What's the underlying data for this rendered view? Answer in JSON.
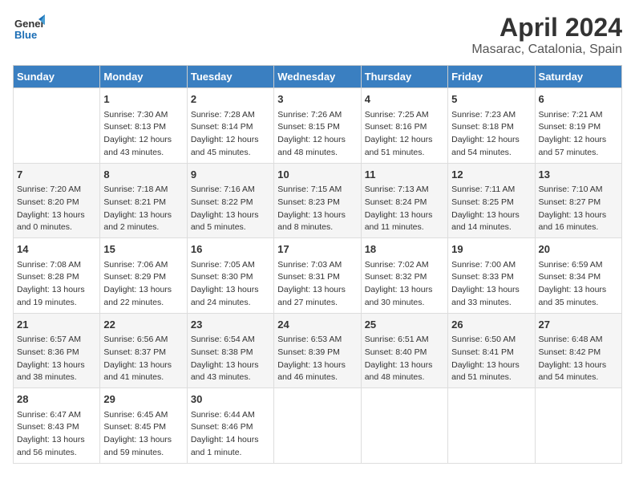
{
  "header": {
    "logo_general": "General",
    "logo_blue": "Blue",
    "month_title": "April 2024",
    "location": "Masarac, Catalonia, Spain"
  },
  "weekdays": [
    "Sunday",
    "Monday",
    "Tuesday",
    "Wednesday",
    "Thursday",
    "Friday",
    "Saturday"
  ],
  "weeks": [
    [
      {
        "day": "",
        "info": ""
      },
      {
        "day": "1",
        "info": "Sunrise: 7:30 AM\nSunset: 8:13 PM\nDaylight: 12 hours\nand 43 minutes."
      },
      {
        "day": "2",
        "info": "Sunrise: 7:28 AM\nSunset: 8:14 PM\nDaylight: 12 hours\nand 45 minutes."
      },
      {
        "day": "3",
        "info": "Sunrise: 7:26 AM\nSunset: 8:15 PM\nDaylight: 12 hours\nand 48 minutes."
      },
      {
        "day": "4",
        "info": "Sunrise: 7:25 AM\nSunset: 8:16 PM\nDaylight: 12 hours\nand 51 minutes."
      },
      {
        "day": "5",
        "info": "Sunrise: 7:23 AM\nSunset: 8:18 PM\nDaylight: 12 hours\nand 54 minutes."
      },
      {
        "day": "6",
        "info": "Sunrise: 7:21 AM\nSunset: 8:19 PM\nDaylight: 12 hours\nand 57 minutes."
      }
    ],
    [
      {
        "day": "7",
        "info": "Sunrise: 7:20 AM\nSunset: 8:20 PM\nDaylight: 13 hours\nand 0 minutes."
      },
      {
        "day": "8",
        "info": "Sunrise: 7:18 AM\nSunset: 8:21 PM\nDaylight: 13 hours\nand 2 minutes."
      },
      {
        "day": "9",
        "info": "Sunrise: 7:16 AM\nSunset: 8:22 PM\nDaylight: 13 hours\nand 5 minutes."
      },
      {
        "day": "10",
        "info": "Sunrise: 7:15 AM\nSunset: 8:23 PM\nDaylight: 13 hours\nand 8 minutes."
      },
      {
        "day": "11",
        "info": "Sunrise: 7:13 AM\nSunset: 8:24 PM\nDaylight: 13 hours\nand 11 minutes."
      },
      {
        "day": "12",
        "info": "Sunrise: 7:11 AM\nSunset: 8:25 PM\nDaylight: 13 hours\nand 14 minutes."
      },
      {
        "day": "13",
        "info": "Sunrise: 7:10 AM\nSunset: 8:27 PM\nDaylight: 13 hours\nand 16 minutes."
      }
    ],
    [
      {
        "day": "14",
        "info": "Sunrise: 7:08 AM\nSunset: 8:28 PM\nDaylight: 13 hours\nand 19 minutes."
      },
      {
        "day": "15",
        "info": "Sunrise: 7:06 AM\nSunset: 8:29 PM\nDaylight: 13 hours\nand 22 minutes."
      },
      {
        "day": "16",
        "info": "Sunrise: 7:05 AM\nSunset: 8:30 PM\nDaylight: 13 hours\nand 24 minutes."
      },
      {
        "day": "17",
        "info": "Sunrise: 7:03 AM\nSunset: 8:31 PM\nDaylight: 13 hours\nand 27 minutes."
      },
      {
        "day": "18",
        "info": "Sunrise: 7:02 AM\nSunset: 8:32 PM\nDaylight: 13 hours\nand 30 minutes."
      },
      {
        "day": "19",
        "info": "Sunrise: 7:00 AM\nSunset: 8:33 PM\nDaylight: 13 hours\nand 33 minutes."
      },
      {
        "day": "20",
        "info": "Sunrise: 6:59 AM\nSunset: 8:34 PM\nDaylight: 13 hours\nand 35 minutes."
      }
    ],
    [
      {
        "day": "21",
        "info": "Sunrise: 6:57 AM\nSunset: 8:36 PM\nDaylight: 13 hours\nand 38 minutes."
      },
      {
        "day": "22",
        "info": "Sunrise: 6:56 AM\nSunset: 8:37 PM\nDaylight: 13 hours\nand 41 minutes."
      },
      {
        "day": "23",
        "info": "Sunrise: 6:54 AM\nSunset: 8:38 PM\nDaylight: 13 hours\nand 43 minutes."
      },
      {
        "day": "24",
        "info": "Sunrise: 6:53 AM\nSunset: 8:39 PM\nDaylight: 13 hours\nand 46 minutes."
      },
      {
        "day": "25",
        "info": "Sunrise: 6:51 AM\nSunset: 8:40 PM\nDaylight: 13 hours\nand 48 minutes."
      },
      {
        "day": "26",
        "info": "Sunrise: 6:50 AM\nSunset: 8:41 PM\nDaylight: 13 hours\nand 51 minutes."
      },
      {
        "day": "27",
        "info": "Sunrise: 6:48 AM\nSunset: 8:42 PM\nDaylight: 13 hours\nand 54 minutes."
      }
    ],
    [
      {
        "day": "28",
        "info": "Sunrise: 6:47 AM\nSunset: 8:43 PM\nDaylight: 13 hours\nand 56 minutes."
      },
      {
        "day": "29",
        "info": "Sunrise: 6:45 AM\nSunset: 8:45 PM\nDaylight: 13 hours\nand 59 minutes."
      },
      {
        "day": "30",
        "info": "Sunrise: 6:44 AM\nSunset: 8:46 PM\nDaylight: 14 hours\nand 1 minute."
      },
      {
        "day": "",
        "info": ""
      },
      {
        "day": "",
        "info": ""
      },
      {
        "day": "",
        "info": ""
      },
      {
        "day": "",
        "info": ""
      }
    ]
  ]
}
